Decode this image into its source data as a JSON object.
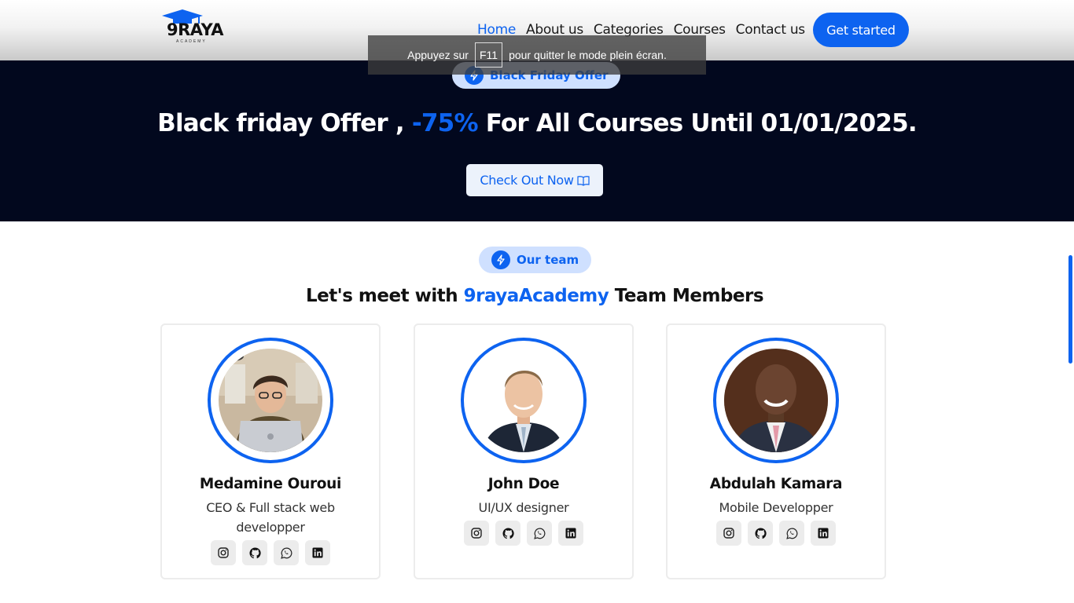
{
  "header": {
    "logo_text": "9RAYA",
    "logo_subtext": "ACADEMY",
    "nav": [
      "Home",
      "About us",
      "Categories",
      "Courses",
      "Contact us"
    ],
    "active_nav": "Home",
    "cta_label": "Get started"
  },
  "fullscreen_notice": {
    "before": "Appuyez sur",
    "key": "F11",
    "after": "pour quitter le mode plein écran."
  },
  "hero": {
    "badge": "Black Friday Offer",
    "title_part1": "Black friday Offer ,",
    "title_accent": "-75%",
    "title_part2": "For All Courses Until 01/01/2025.",
    "button_label": "Check Out Now"
  },
  "team": {
    "badge": "Our team",
    "heading_part1": "Let's meet with",
    "heading_accent": "9rayaAcademy",
    "heading_part2": "Team Members",
    "members": [
      {
        "name": "Medamine Ouroui",
        "role": "CEO & Full stack web developper"
      },
      {
        "name": "John Doe",
        "role": "UI/UX designer"
      },
      {
        "name": "Abdulah Kamara",
        "role": "Mobile Developper"
      }
    ],
    "social_icons": [
      "instagram-icon",
      "github-icon",
      "whatsapp-icon",
      "linkedin-icon"
    ]
  },
  "colors": {
    "accent": "#0d63f0",
    "hero_bg": "#02081e",
    "badge_bg": "#cfe0ff"
  }
}
